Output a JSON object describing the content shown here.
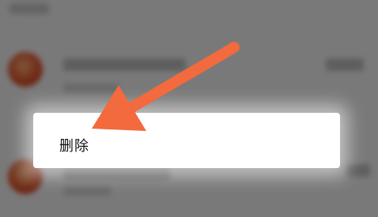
{
  "context_menu": {
    "delete_label": "删除"
  },
  "annotation": {
    "arrow_color": "#f26a3d"
  },
  "background": {
    "avatar_color": "#e2522c"
  }
}
